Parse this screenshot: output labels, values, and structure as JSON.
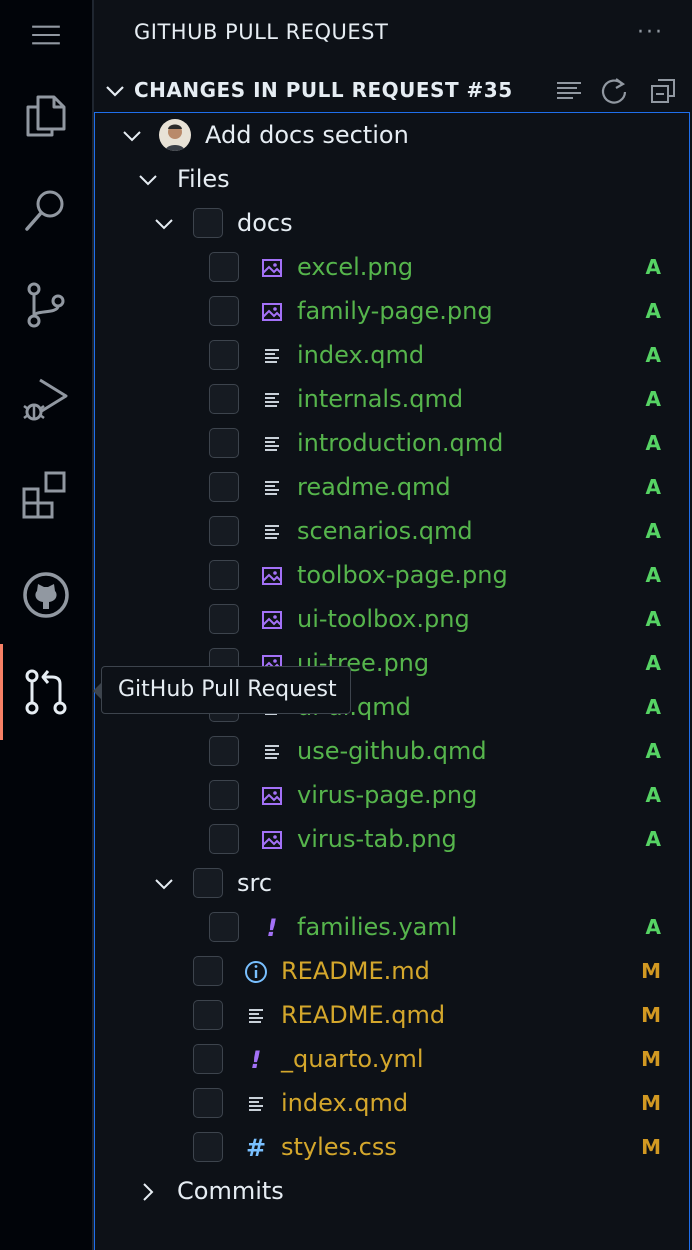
{
  "colors": {
    "background": "#0d1117",
    "activity_bar": "#010409",
    "active_indicator": "#f78166",
    "focus_border": "#1f6feb",
    "added": "#56b54c",
    "modified": "#d4a72c",
    "image_icon": "#a371f7"
  },
  "activity_bar": {
    "items": [
      {
        "icon": "explorer-icon"
      },
      {
        "icon": "search-icon"
      },
      {
        "icon": "source-control-icon"
      },
      {
        "icon": "run-debug-icon"
      },
      {
        "icon": "extensions-icon"
      },
      {
        "icon": "github-icon"
      },
      {
        "icon": "pull-request-icon",
        "active": true
      }
    ]
  },
  "tooltip": "GitHub Pull Request",
  "sidebar": {
    "title": "GITHUB PULL REQUEST",
    "more": "···",
    "section": {
      "title": "CHANGES IN PULL REQUEST #35",
      "actions": [
        "list-view-icon",
        "refresh-icon",
        "collapse-all-icon"
      ]
    }
  },
  "tree": {
    "commit": {
      "label": "Add docs section"
    },
    "files_label": "Files",
    "docs_folder": "docs",
    "docs_files": [
      {
        "name": "excel.png",
        "icon": "image-icon",
        "status": "A"
      },
      {
        "name": "family-page.png",
        "icon": "image-icon",
        "status": "A"
      },
      {
        "name": "index.qmd",
        "icon": "text-file-icon",
        "status": "A"
      },
      {
        "name": "internals.qmd",
        "icon": "text-file-icon",
        "status": "A"
      },
      {
        "name": "introduction.qmd",
        "icon": "text-file-icon",
        "status": "A"
      },
      {
        "name": "readme.qmd",
        "icon": "text-file-icon",
        "status": "A"
      },
      {
        "name": "scenarios.qmd",
        "icon": "text-file-icon",
        "status": "A"
      },
      {
        "name": "toolbox-page.png",
        "icon": "image-icon",
        "status": "A"
      },
      {
        "name": "ui-toolbox.png",
        "icon": "image-icon",
        "status": "A"
      },
      {
        "name": "ui-tree.png",
        "icon": "image-icon",
        "status": "A"
      },
      {
        "name": "ui-ui.qmd",
        "icon": "text-file-icon",
        "status": "A"
      },
      {
        "name": "use-github.qmd",
        "icon": "text-file-icon",
        "status": "A"
      },
      {
        "name": "virus-page.png",
        "icon": "image-icon",
        "status": "A"
      },
      {
        "name": "virus-tab.png",
        "icon": "image-icon",
        "status": "A"
      }
    ],
    "src_folder": "src",
    "src_files": [
      {
        "name": "families.yaml",
        "icon": "yaml-icon",
        "status": "A"
      }
    ],
    "root_files": [
      {
        "name": "README.md",
        "icon": "info-icon",
        "status": "M"
      },
      {
        "name": "README.qmd",
        "icon": "text-file-icon",
        "status": "M"
      },
      {
        "name": "_quarto.yml",
        "icon": "yaml-icon",
        "status": "M"
      },
      {
        "name": "index.qmd",
        "icon": "text-file-icon",
        "status": "M"
      },
      {
        "name": "styles.css",
        "icon": "css-icon",
        "status": "M"
      }
    ],
    "commits_label": "Commits"
  }
}
